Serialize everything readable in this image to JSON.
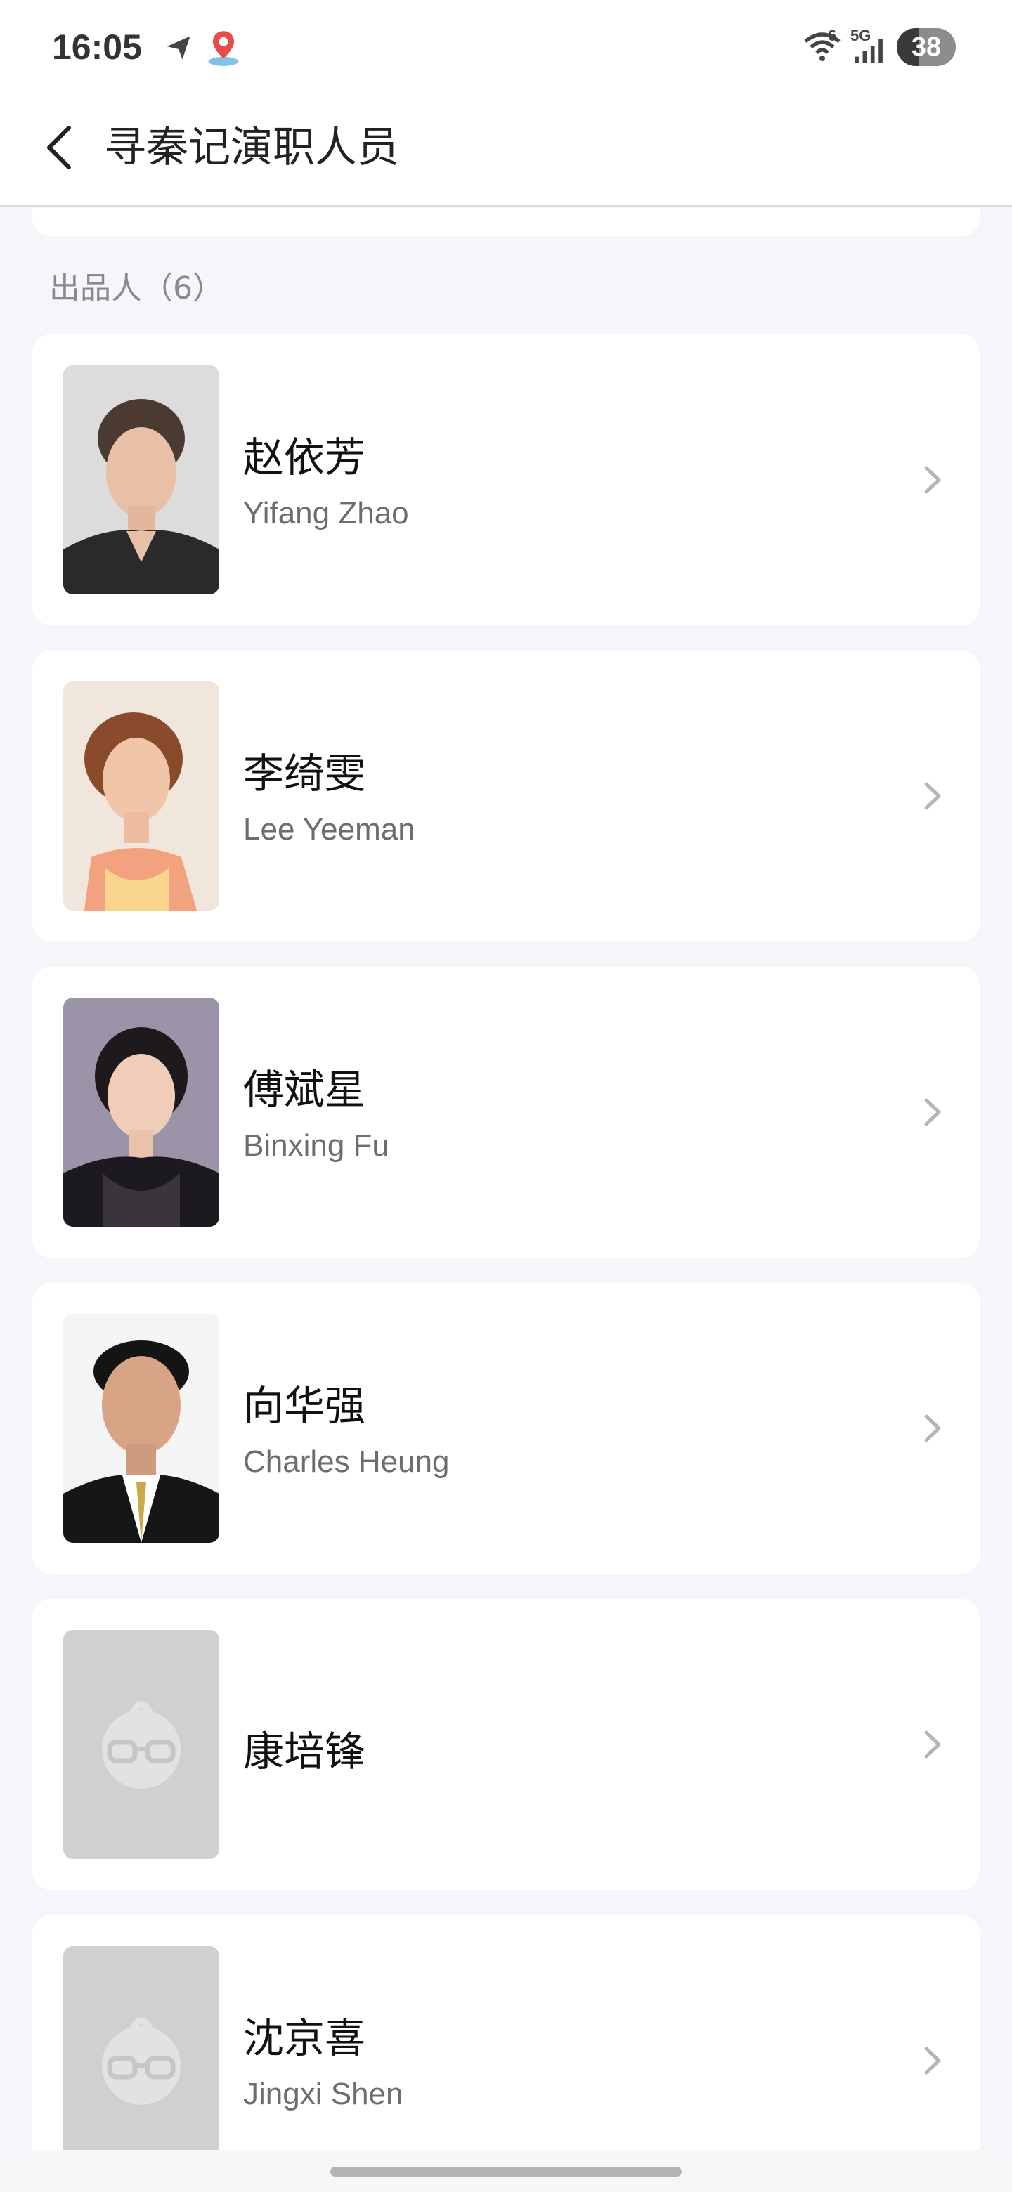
{
  "status_bar": {
    "time": "16:05",
    "network_label": "5G",
    "wifi_label": "6",
    "battery": "38",
    "icons": [
      "send-icon",
      "location-pin-icon",
      "wifi-icon",
      "cellular-signal-icon",
      "battery-icon"
    ]
  },
  "header": {
    "back_icon": "back-arrow-icon",
    "title": "寻秦记演职人员"
  },
  "section": {
    "title": "出品人（6）"
  },
  "people": [
    {
      "name_cn": "赵依芳",
      "name_en": "Yifang Zhao",
      "photo": "portrait"
    },
    {
      "name_cn": "李绮雯",
      "name_en": "Lee Yeeman",
      "photo": "portrait"
    },
    {
      "name_cn": "傅斌星",
      "name_en": "Binxing Fu",
      "photo": "portrait"
    },
    {
      "name_cn": "向华强",
      "name_en": "Charles Heung",
      "photo": "portrait"
    },
    {
      "name_cn": "康培锋",
      "name_en": "",
      "photo": "placeholder-avatar"
    },
    {
      "name_cn": "沈京喜",
      "name_en": "Jingxi Shen",
      "photo": "placeholder-avatar"
    }
  ],
  "colors": {
    "background": "#f5f6fa",
    "card": "#ffffff",
    "placeholder": "#d0d0d0",
    "secondary_text": "#6d6d6d"
  }
}
